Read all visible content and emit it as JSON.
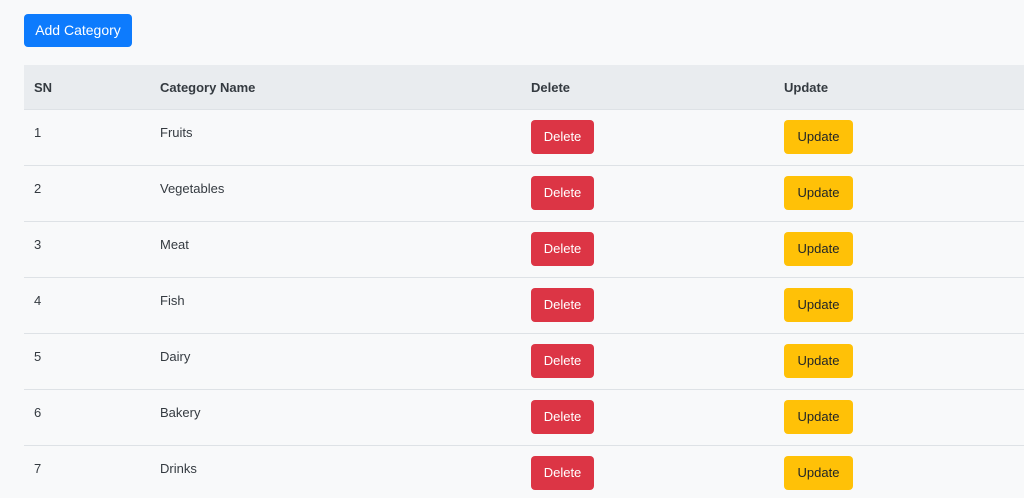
{
  "toolbar": {
    "add_label": "Add Category"
  },
  "table": {
    "headers": {
      "sn": "SN",
      "name": "Category Name",
      "delete": "Delete",
      "update": "Update"
    },
    "rows": [
      {
        "sn": "1",
        "name": "Fruits",
        "delete_label": "Delete",
        "update_label": "Update"
      },
      {
        "sn": "2",
        "name": "Vegetables",
        "delete_label": "Delete",
        "update_label": "Update"
      },
      {
        "sn": "3",
        "name": "Meat",
        "delete_label": "Delete",
        "update_label": "Update"
      },
      {
        "sn": "4",
        "name": "Fish",
        "delete_label": "Delete",
        "update_label": "Update"
      },
      {
        "sn": "5",
        "name": "Dairy",
        "delete_label": "Delete",
        "update_label": "Update"
      },
      {
        "sn": "6",
        "name": "Bakery",
        "delete_label": "Delete",
        "update_label": "Update"
      },
      {
        "sn": "7",
        "name": "Drinks",
        "delete_label": "Delete",
        "update_label": "Update"
      }
    ]
  },
  "colors": {
    "primary": "#0d7bfd",
    "danger": "#dc3545",
    "warning": "#ffc107",
    "header_bg": "#e9ecef",
    "page_bg": "#f8f9fa"
  }
}
